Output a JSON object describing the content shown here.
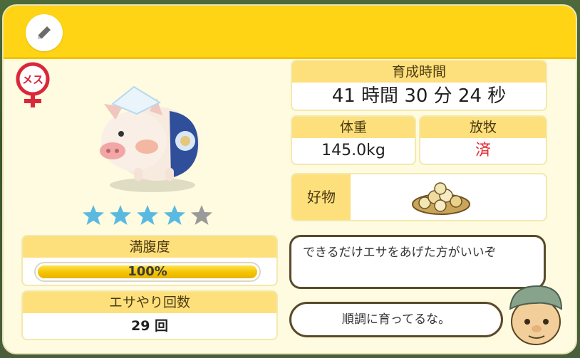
{
  "header": {
    "edit_icon": "pencil-icon"
  },
  "pig": {
    "gender_label": "メス",
    "rating": 4,
    "rating_max": 5
  },
  "stats": {
    "fullness": {
      "label": "満腹度",
      "value_text": "100%",
      "fraction": 1.0
    },
    "feed_count": {
      "label": "エサやり回数",
      "value": "29 回"
    },
    "growth_time": {
      "label": "育成時間",
      "value": "41 時間 30 分 24 秒"
    },
    "weight": {
      "label": "体重",
      "value": "145.0kg"
    },
    "grazing": {
      "label": "放牧",
      "value": "済"
    },
    "favorite": {
      "label": "好物"
    }
  },
  "dialogue": {
    "advice": "できるだけエサをあげた方がいいぞ",
    "comment": "順調に育ってるな。"
  },
  "colors": {
    "accent": "#ffd414",
    "label_bg": "#fde07c",
    "grazing_done": "#e3262d",
    "star_on": "#5ab9e0",
    "star_off": "#9a9a9a"
  }
}
